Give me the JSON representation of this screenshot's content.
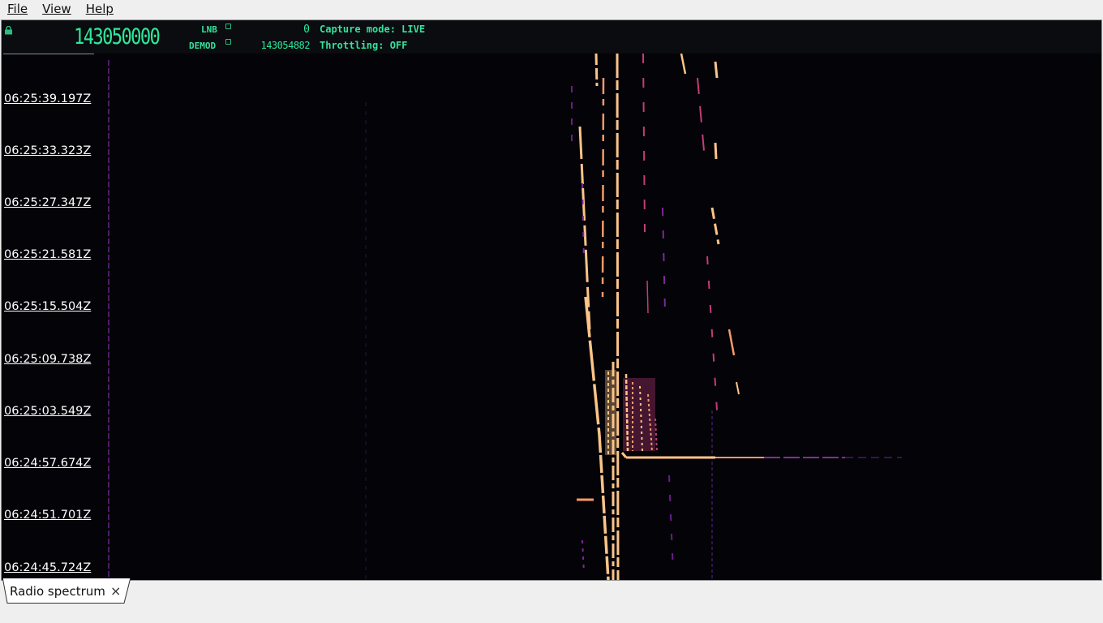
{
  "menu": {
    "file": "File",
    "view": "View",
    "help": "Help"
  },
  "header": {
    "frequency": "143050000",
    "lnb_label": "LNB",
    "lnb_value": "0",
    "demod_label": "DEMOD",
    "demod_value": "143054882",
    "capture_mode": "Capture mode: LIVE",
    "throttling": "Throttling: OFF"
  },
  "timestamps": [
    "06:25:39.197Z",
    "06:25:33.323Z",
    "06:25:27.347Z",
    "06:25:21.581Z",
    "06:25:15.504Z",
    "06:25:09.738Z",
    "06:25:03.549Z",
    "06:24:57.674Z",
    "06:24:51.701Z",
    "06:24:45.724Z"
  ],
  "tab": {
    "label": "Radio spectrum",
    "close": "×"
  },
  "colors": {
    "accent_green": "#2ee89a",
    "waterfall_bg": "#030308",
    "signal_hot": "#fcc488",
    "signal_mid": "#c43c7a",
    "signal_low": "#6a1d8c"
  },
  "icons": {
    "lock": "lock-icon",
    "close": "close-icon"
  }
}
